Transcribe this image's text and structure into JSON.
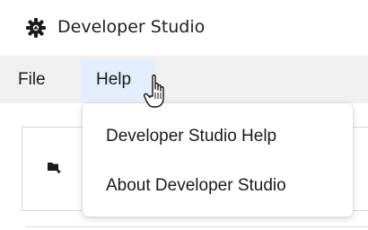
{
  "window": {
    "title": "Developer Studio",
    "icon": "gear-app-icon"
  },
  "menubar": {
    "items": [
      {
        "label": "File",
        "state": "normal"
      },
      {
        "label": "Help",
        "state": "open"
      }
    ]
  },
  "help_menu": {
    "items": [
      {
        "label": "Developer Studio Help"
      },
      {
        "label": "About Developer Studio"
      }
    ]
  },
  "toolbar": {
    "icons": [
      "new-folder-icon"
    ]
  },
  "cursor": {
    "type": "hand-pointer-icon"
  },
  "colors": {
    "menubar_bg": "#f0f0f0",
    "menu_highlight": "#e2eefb",
    "text": "#1a1a1a"
  }
}
